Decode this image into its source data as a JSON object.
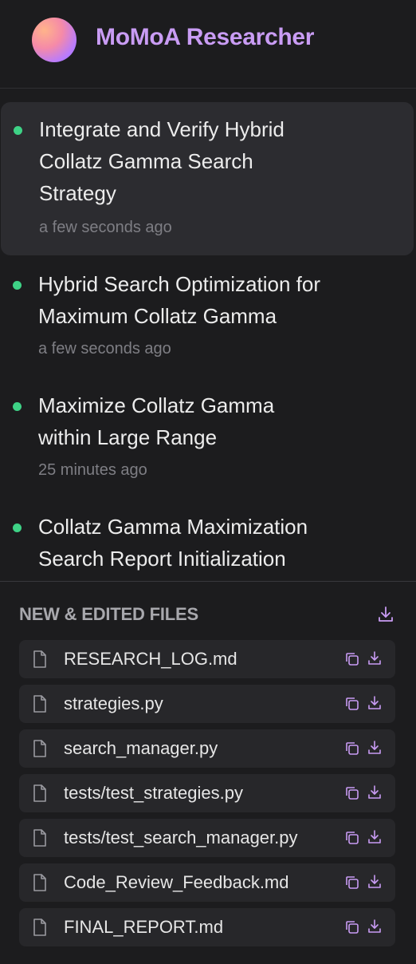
{
  "app": {
    "title": "MoMoA Researcher"
  },
  "sessions": [
    {
      "title_lines": [
        "Integrate and Verify Hybrid",
        "Collatz Gamma Search",
        "Strategy"
      ],
      "time": "a few seconds ago",
      "active": true
    },
    {
      "title_lines": [
        "Hybrid Search Optimization for",
        "Maximum Collatz Gamma"
      ],
      "time": "a few seconds ago",
      "active": false
    },
    {
      "title_lines": [
        "Maximize Collatz Gamma",
        "within Large Range"
      ],
      "time": "25 minutes ago",
      "active": false
    },
    {
      "title_lines": [
        "Collatz Gamma Maximization",
        "Search Report Initialization"
      ],
      "time": "",
      "active": false
    }
  ],
  "files": {
    "header": "NEW & EDITED FILES",
    "items": [
      {
        "name": "RESEARCH_LOG.md"
      },
      {
        "name": "strategies.py"
      },
      {
        "name": "search_manager.py"
      },
      {
        "name": "tests/test_strategies.py"
      },
      {
        "name": "tests/test_search_manager.py"
      },
      {
        "name": "Code_Review_Feedback.md"
      },
      {
        "name": "FINAL_REPORT.md"
      }
    ]
  },
  "icons": {
    "file": "document-icon",
    "copy": "copy-icon",
    "download": "download-icon"
  },
  "colors": {
    "accent": "#c99cf4",
    "status_dot": "#3ed286",
    "background": "#1c1c1e",
    "active_item": "#2c2c30",
    "file_row": "#27272a"
  }
}
